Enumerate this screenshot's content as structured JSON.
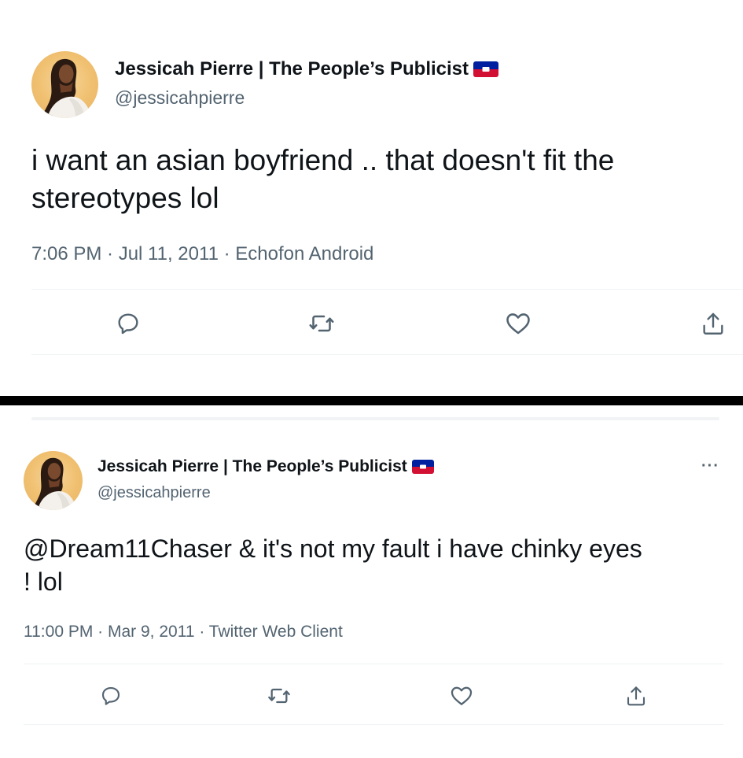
{
  "tweets": [
    {
      "author": {
        "name": "Jessicah Pierre | The People’s Publicist",
        "handle": "@jessicahpierre",
        "flag": "haiti-flag-icon"
      },
      "text": "i want an asian boyfriend .. that doesn't fit the\nstereotypes lol",
      "meta": "7:06 PM · Jul 11, 2011 · Echofon Android",
      "actions": [
        "reply-icon",
        "retweet-icon",
        "like-icon",
        "share-icon"
      ]
    },
    {
      "author": {
        "name": "Jessicah Pierre | The People’s Publicist",
        "handle": "@jessicahpierre",
        "flag": "haiti-flag-icon"
      },
      "more": "···",
      "text": "@Dream11Chaser & it's not my fault i have chinky eyes\n! lol",
      "meta": "11:00 PM · Mar 9, 2011 · Twitter Web Client",
      "actions": [
        "reply-icon",
        "retweet-icon",
        "like-icon",
        "share-icon"
      ]
    }
  ],
  "colors": {
    "text": "#0f1419",
    "secondary": "#536471",
    "divider": "#eff3f4",
    "separator": "#000000"
  }
}
